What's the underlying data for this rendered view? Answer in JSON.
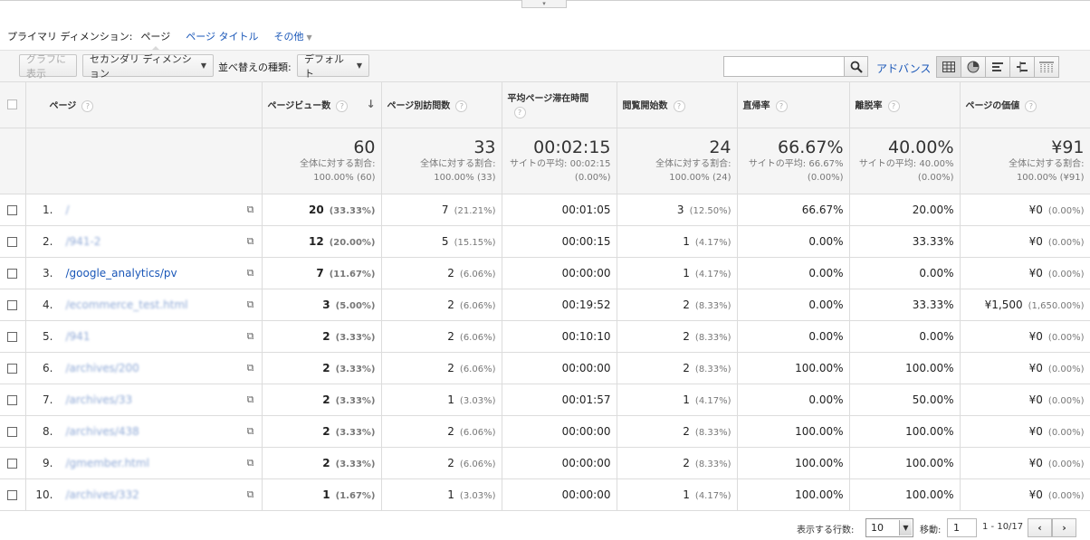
{
  "collapse_toggle": "▾",
  "dimension_bar": {
    "label": "プライマリ ディメンション:",
    "active": "ページ",
    "options": [
      "ページ タイトル"
    ],
    "more": "その他"
  },
  "toolbar": {
    "chart_button": "グラフに表示",
    "secondary_dimension": "セカンダリ ディメンション",
    "sort_label": "並べ替えの種類:",
    "sort_value": "デフォルト",
    "search_value": "",
    "advanced_link": "アドバンス"
  },
  "columns": [
    {
      "key": "page",
      "label": "ページ"
    },
    {
      "key": "pageviews",
      "label": "ページビュー数"
    },
    {
      "key": "unique",
      "label": "ページ別訪問数"
    },
    {
      "key": "avg_time",
      "label": "平均ページ滞在時間"
    },
    {
      "key": "entrances",
      "label": "閲覧開始数"
    },
    {
      "key": "bounce",
      "label": "直帰率"
    },
    {
      "key": "exit",
      "label": "離脱率"
    },
    {
      "key": "value",
      "label": "ページの価値"
    }
  ],
  "totals": {
    "pageviews": {
      "big": "60",
      "line1": "全体に対する割合:",
      "line2": "100.00% (60)"
    },
    "unique": {
      "big": "33",
      "line1": "全体に対する割合:",
      "line2": "100.00% (33)"
    },
    "avg_time": {
      "big": "00:02:15",
      "line1": "サイトの平均: 00:02:15",
      "line2": "(0.00%)"
    },
    "entrances": {
      "big": "24",
      "line1": "全体に対する割合:",
      "line2": "100.00% (24)"
    },
    "bounce": {
      "big": "66.67%",
      "line1": "サイトの平均: 66.67%",
      "line2": "(0.00%)"
    },
    "exit": {
      "big": "40.00%",
      "line1": "サイトの平均: 40.00%",
      "line2": "(0.00%)"
    },
    "value": {
      "big": "¥91",
      "line1": "全体に対する割合:",
      "line2": "100.00% (¥91)"
    }
  },
  "rows": [
    {
      "idx": "1.",
      "page": "/",
      "blur": true,
      "pv": "20",
      "pv_pct": "(33.33%)",
      "uq": "7",
      "uq_pct": "(21.21%)",
      "time": "00:01:05",
      "ent": "3",
      "ent_pct": "(12.50%)",
      "bounce": "66.67%",
      "exit": "20.00%",
      "val": "¥0",
      "val_pct": "(0.00%)"
    },
    {
      "idx": "2.",
      "page": "/941-2",
      "blur": true,
      "pv": "12",
      "pv_pct": "(20.00%)",
      "uq": "5",
      "uq_pct": "(15.15%)",
      "time": "00:00:15",
      "ent": "1",
      "ent_pct": "(4.17%)",
      "bounce": "0.00%",
      "exit": "33.33%",
      "val": "¥0",
      "val_pct": "(0.00%)"
    },
    {
      "idx": "3.",
      "page": "/google_analytics/pv",
      "blur": false,
      "pv": "7",
      "pv_pct": "(11.67%)",
      "uq": "2",
      "uq_pct": "(6.06%)",
      "time": "00:00:00",
      "ent": "1",
      "ent_pct": "(4.17%)",
      "bounce": "0.00%",
      "exit": "0.00%",
      "val": "¥0",
      "val_pct": "(0.00%)"
    },
    {
      "idx": "4.",
      "page": "/ecommerce_test.html",
      "blur": true,
      "pv": "3",
      "pv_pct": "(5.00%)",
      "uq": "2",
      "uq_pct": "(6.06%)",
      "time": "00:19:52",
      "ent": "2",
      "ent_pct": "(8.33%)",
      "bounce": "0.00%",
      "exit": "33.33%",
      "val": "¥1,500",
      "val_pct": "(1,650.00%)"
    },
    {
      "idx": "5.",
      "page": "/941",
      "blur": true,
      "pv": "2",
      "pv_pct": "(3.33%)",
      "uq": "2",
      "uq_pct": "(6.06%)",
      "time": "00:10:10",
      "ent": "2",
      "ent_pct": "(8.33%)",
      "bounce": "0.00%",
      "exit": "0.00%",
      "val": "¥0",
      "val_pct": "(0.00%)"
    },
    {
      "idx": "6.",
      "page": "/archives/200",
      "blur": true,
      "pv": "2",
      "pv_pct": "(3.33%)",
      "uq": "2",
      "uq_pct": "(6.06%)",
      "time": "00:00:00",
      "ent": "2",
      "ent_pct": "(8.33%)",
      "bounce": "100.00%",
      "exit": "100.00%",
      "val": "¥0",
      "val_pct": "(0.00%)"
    },
    {
      "idx": "7.",
      "page": "/archives/33",
      "blur": true,
      "pv": "2",
      "pv_pct": "(3.33%)",
      "uq": "1",
      "uq_pct": "(3.03%)",
      "time": "00:01:57",
      "ent": "1",
      "ent_pct": "(4.17%)",
      "bounce": "0.00%",
      "exit": "50.00%",
      "val": "¥0",
      "val_pct": "(0.00%)"
    },
    {
      "idx": "8.",
      "page": "/archives/438",
      "blur": true,
      "pv": "2",
      "pv_pct": "(3.33%)",
      "uq": "2",
      "uq_pct": "(6.06%)",
      "time": "00:00:00",
      "ent": "2",
      "ent_pct": "(8.33%)",
      "bounce": "100.00%",
      "exit": "100.00%",
      "val": "¥0",
      "val_pct": "(0.00%)"
    },
    {
      "idx": "9.",
      "page": "/gmember.html",
      "blur": true,
      "pv": "2",
      "pv_pct": "(3.33%)",
      "uq": "2",
      "uq_pct": "(6.06%)",
      "time": "00:00:00",
      "ent": "2",
      "ent_pct": "(8.33%)",
      "bounce": "100.00%",
      "exit": "100.00%",
      "val": "¥0",
      "val_pct": "(0.00%)"
    },
    {
      "idx": "10.",
      "page": "/archives/332",
      "blur": true,
      "pv": "1",
      "pv_pct": "(1.67%)",
      "uq": "1",
      "uq_pct": "(3.03%)",
      "time": "00:00:00",
      "ent": "1",
      "ent_pct": "(4.17%)",
      "bounce": "100.00%",
      "exit": "100.00%",
      "val": "¥0",
      "val_pct": "(0.00%)"
    }
  ],
  "footer": {
    "rows_label": "表示する行数:",
    "rows_value": "10",
    "goto_label": "移動:",
    "goto_value": "1",
    "range": "1 - 10/17",
    "prev": "‹",
    "next": "›"
  },
  "colors": {
    "link": "#1a57b8",
    "header_bg": "#f5f5f5",
    "border": "#dcdcdc"
  }
}
